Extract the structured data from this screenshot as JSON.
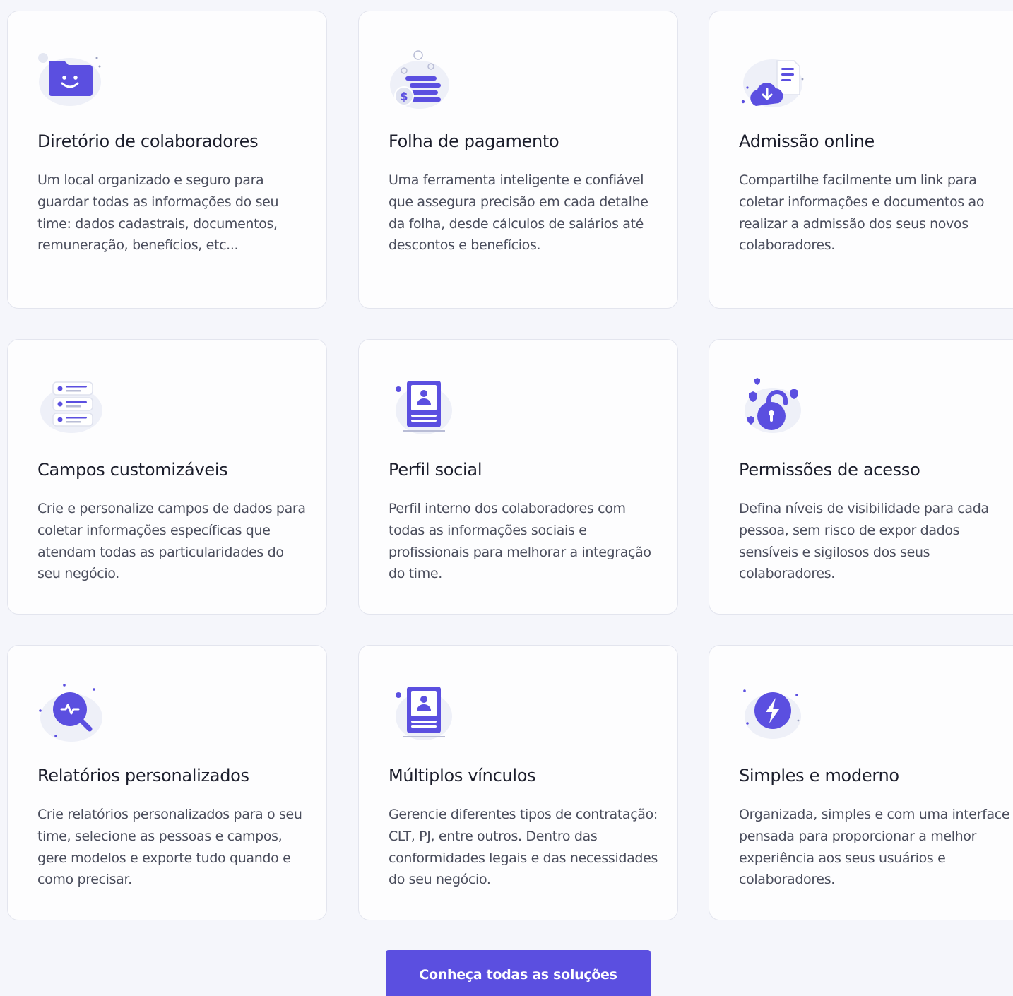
{
  "colors": {
    "accent": "#5b4fe0",
    "background": "#f5f6fb",
    "card": "#fdfdfe",
    "title": "#1b1d2b",
    "text": "#4a4d5c"
  },
  "features": [
    {
      "icon": "folder-smile-icon",
      "title": "Diretório de colaboradores",
      "description": "Um local organizado e seguro para guardar todas as informações do seu time: dados cadastrais, documentos, remuneração, benefícios, etc..."
    },
    {
      "icon": "coins-money-icon",
      "title": "Folha de pagamento",
      "description": "Uma ferramenta inteligente e confiável que assegura precisão em cada detalhe da folha, desde cálculos de salários até descontos e benefícios."
    },
    {
      "icon": "cloud-download-document-icon",
      "title": "Admissão online",
      "description": "Compartilhe facilmente um link para coletar informações e documentos ao realizar a admissão dos seus novos colaboradores."
    },
    {
      "icon": "form-fields-icon",
      "title": "Campos customizáveis",
      "description": "Crie e personalize campos de dados para coletar informações específicas que atendam todas as particularidades do seu negócio."
    },
    {
      "icon": "profile-card-icon",
      "title": "Perfil social",
      "description": "Perfil interno dos colaboradores com todas as informações sociais e profissionais para melhorar a integração do time."
    },
    {
      "icon": "padlock-shield-icon",
      "title": "Permissões de acesso",
      "description": "Defina níveis de visibilidade para cada pessoa, sem risco de expor dados sensíveis e sigilosos dos seus colaboradores."
    },
    {
      "icon": "search-report-icon",
      "title": "Relatórios personalizados",
      "description": "Crie relatórios personalizados para o seu time, selecione as pessoas e campos, gere modelos e exporte tudo quando e como precisar."
    },
    {
      "icon": "profile-card-icon",
      "title": "Múltiplos vínculos",
      "description": "Gerencie diferentes tipos de contratação: CLT, PJ, entre outros. Dentro das conformidades legais e das necessidades do seu negócio."
    },
    {
      "icon": "lightning-icon",
      "title": "Simples e moderno",
      "description": "Organizada, simples e com uma interface pensada para proporcionar a melhor experiência aos seus usuários e colaboradores."
    }
  ],
  "cta": {
    "label": "Conheça todas as soluções"
  }
}
